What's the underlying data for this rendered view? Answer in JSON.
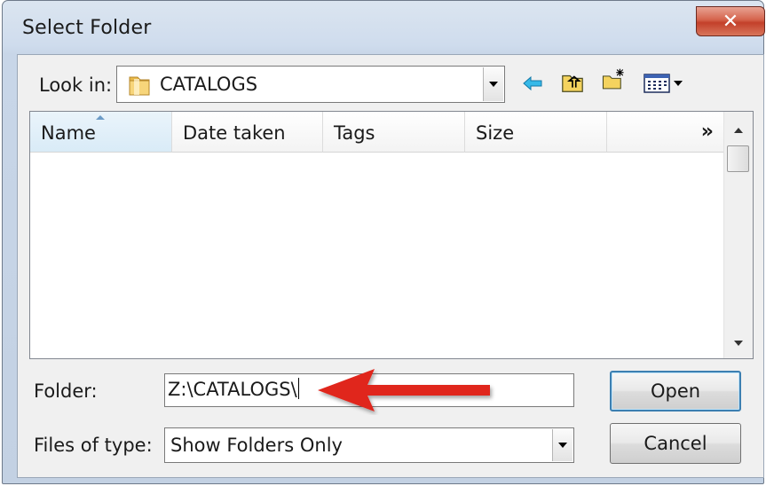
{
  "window": {
    "title": "Select Folder",
    "close_glyph": "✕"
  },
  "look_in": {
    "label": "Look in:",
    "value": "CATALOGS",
    "icon": "folder-icon"
  },
  "toolbar": {
    "icons": [
      "back-arrow-icon",
      "up-folder-icon",
      "new-folder-icon",
      "view-menu-icon"
    ]
  },
  "list": {
    "columns": [
      {
        "label": "Name",
        "sorted": true
      },
      {
        "label": "Date taken"
      },
      {
        "label": "Tags"
      },
      {
        "label": "Size"
      }
    ],
    "more_columns_glyph": "»",
    "items": []
  },
  "folder": {
    "label": "Folder:",
    "value": "Z:\\CATALOGS\\"
  },
  "files_of_type": {
    "label": "Files of type:",
    "value": "Show Folders Only"
  },
  "buttons": {
    "open": "Open",
    "cancel": "Cancel"
  },
  "colors": {
    "arrow": "#e0251b",
    "accent": "#3c7fb1"
  }
}
